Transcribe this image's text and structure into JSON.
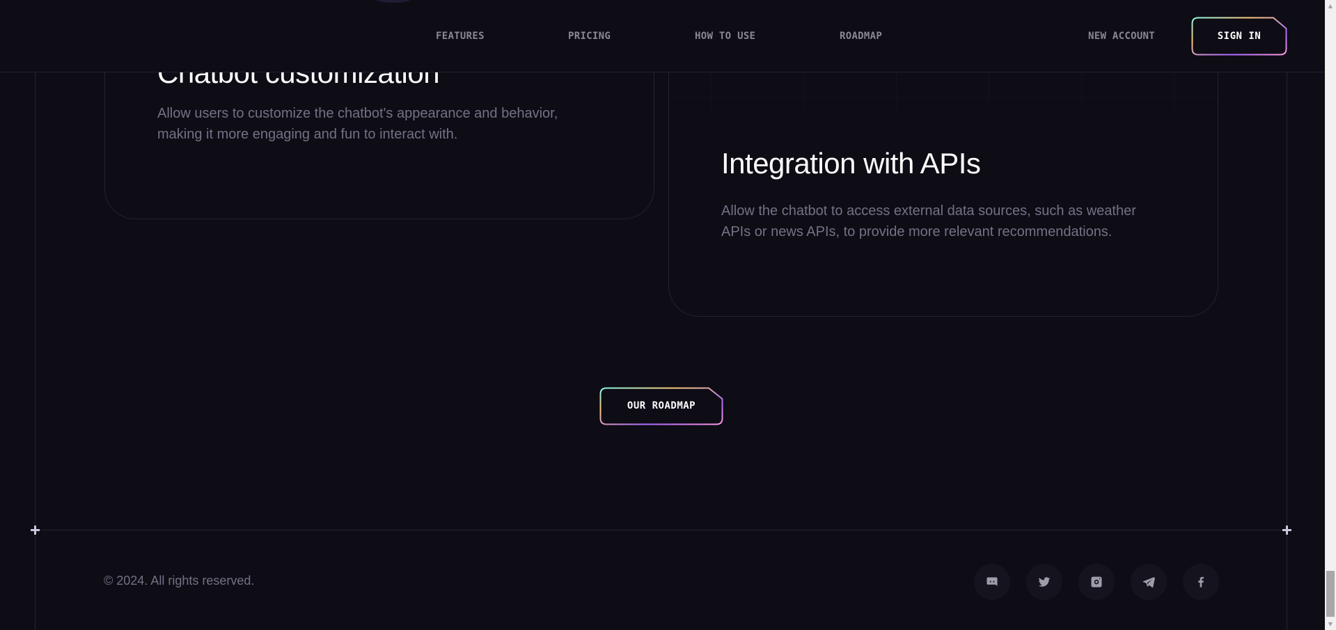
{
  "header": {
    "nav": {
      "features": "FEATURES",
      "pricing": "PRICING",
      "how_to_use": "HOW TO USE",
      "roadmap": "ROADMAP"
    },
    "new_account": "NEW ACCOUNT",
    "sign_in": "SIGN IN"
  },
  "cards": [
    {
      "title": "Chatbot customization",
      "text": "Allow users to customize the chatbot's appearance and behavior, making it more engaging and fun to interact with."
    },
    {
      "title": "Integration with APIs",
      "text": "Allow the chatbot to access external data sources, such as weather APIs or news APIs, to provide more relevant recommendations."
    }
  ],
  "roadmap_button": "OUR ROADMAP",
  "footer": {
    "copyright": "© 2024. All rights reserved.",
    "socials": [
      "discord-icon",
      "twitter-icon",
      "instagram-icon",
      "telegram-icon",
      "facebook-icon"
    ]
  },
  "colors": {
    "background": "#0e0c15",
    "text": "#fefefe",
    "muted": "#757185",
    "gradient": [
      "#89f9e8",
      "#facb7b",
      "#ac6aff",
      "#ff98e2"
    ]
  }
}
